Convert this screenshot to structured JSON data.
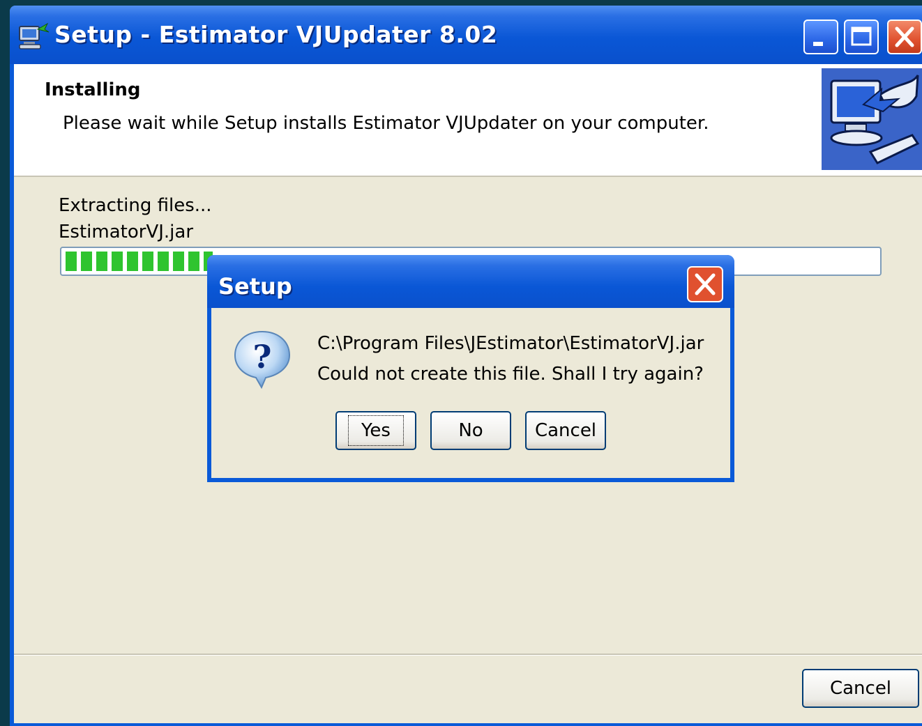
{
  "window": {
    "title": "Setup - Estimator VJUpdater 8.02",
    "app_icon": "computer-install-icon",
    "controls": [
      "minimize-icon",
      "maximize-icon",
      "close-icon"
    ]
  },
  "header": {
    "title": "Installing",
    "subtitle": "Please wait while Setup installs Estimator VJUpdater on your computer.",
    "image": "computer-install-graphic"
  },
  "progress": {
    "status": "Extracting files...",
    "current_file": "EstimatorVJ.jar",
    "percent": 18
  },
  "footer": {
    "cancel_label": "Cancel"
  },
  "dialog": {
    "title": "Setup",
    "icon": "question-icon",
    "message_path": "C:\\Program Files\\JEstimator\\EstimatorVJ.jar",
    "message_text": "Could not create this file. Shall I try again?",
    "yes_label": "Yes",
    "no_label": "No",
    "cancel_label": "Cancel"
  },
  "colors": {
    "titlebar": "#0a57d6",
    "client": "#ece9d8",
    "progress_fill": "#2fc42f",
    "close_button": "#e0512f"
  }
}
